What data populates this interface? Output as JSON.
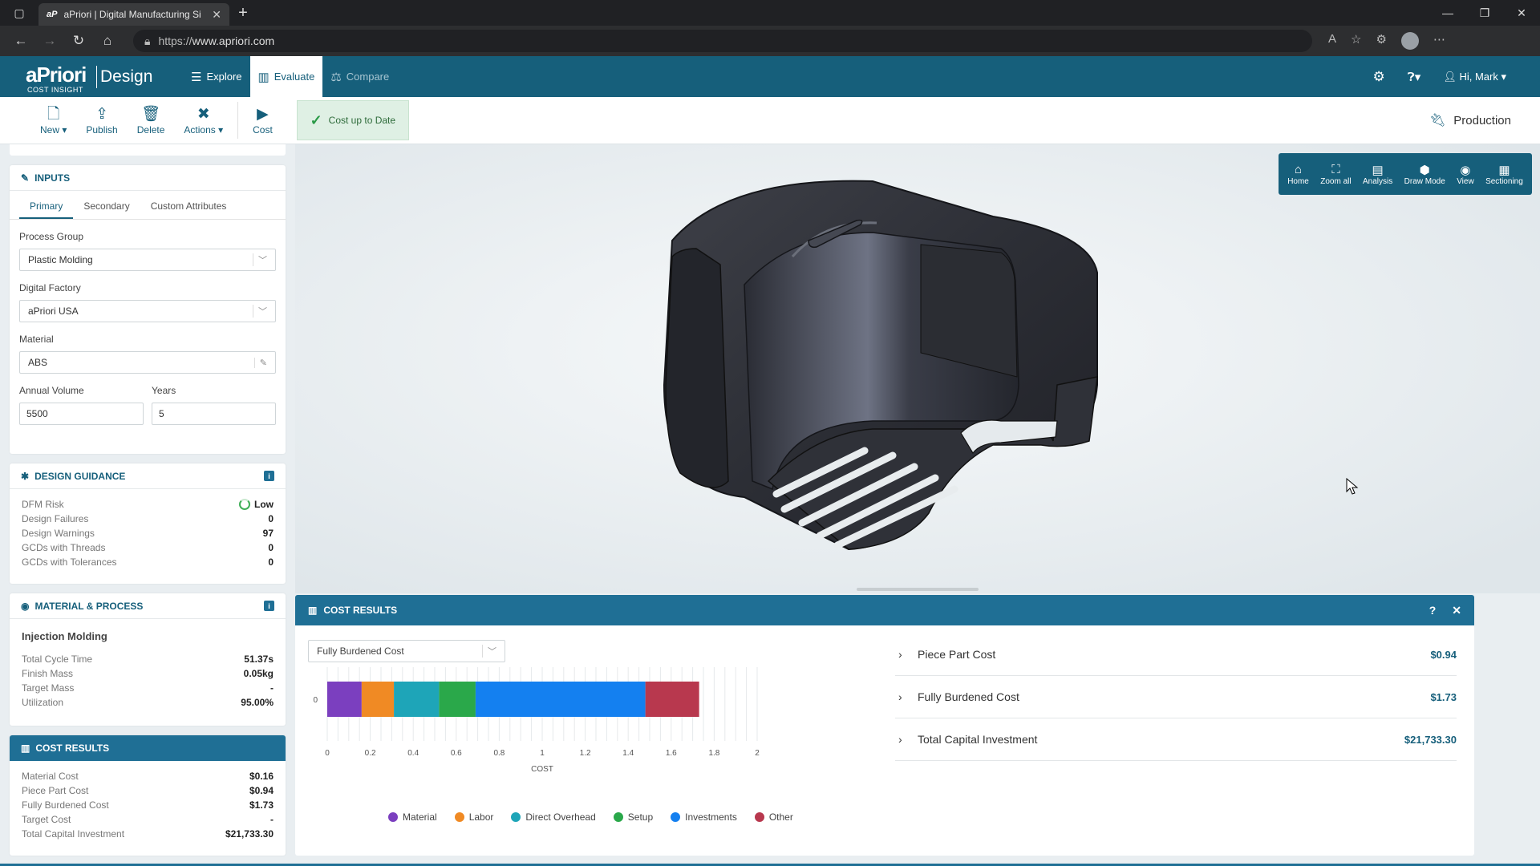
{
  "browser": {
    "tab_favicon": "aP",
    "tab_title": "aPriori | Digital Manufacturing Si",
    "url_scheme": "https://",
    "url_host": "www.apriori.com"
  },
  "header": {
    "logo_main": "aPriori",
    "logo_sub": "COST INSIGHT",
    "logo_product": "Design",
    "nav": [
      {
        "label": "Explore"
      },
      {
        "label": "Evaluate"
      },
      {
        "label": "Compare"
      }
    ],
    "user": "Hi, Mark"
  },
  "toolbar": {
    "new": "New",
    "publish": "Publish",
    "delete": "Delete",
    "actions": "Actions",
    "cost": "Cost",
    "status": "Cost up to Date",
    "scenario_state": "Production"
  },
  "inputs": {
    "title": "INPUTS",
    "tabs": [
      "Primary",
      "Secondary",
      "Custom Attributes"
    ],
    "process_group_label": "Process Group",
    "process_group": "Plastic Molding",
    "digital_factory_label": "Digital Factory",
    "digital_factory": "aPriori USA",
    "material_label": "Material",
    "material": "ABS",
    "annual_volume_label": "Annual Volume",
    "annual_volume": "5500",
    "years_label": "Years",
    "years": "5"
  },
  "design_guidance": {
    "title": "DESIGN GUIDANCE",
    "rows": [
      {
        "k": "DFM Risk",
        "v": "Low"
      },
      {
        "k": "Design Failures",
        "v": "0"
      },
      {
        "k": "Design Warnings",
        "v": "97"
      },
      {
        "k": "GCDs with Threads",
        "v": "0"
      },
      {
        "k": "GCDs with Tolerances",
        "v": "0"
      }
    ]
  },
  "material_process": {
    "title": "MATERIAL & PROCESS",
    "process": "Injection Molding",
    "rows": [
      {
        "k": "Total Cycle Time",
        "v": "51.37s"
      },
      {
        "k": "Finish Mass",
        "v": "0.05kg"
      },
      {
        "k": "Target Mass",
        "v": "-"
      },
      {
        "k": "Utilization",
        "v": "95.00%"
      }
    ]
  },
  "cost_results_side": {
    "title": "COST RESULTS",
    "rows": [
      {
        "k": "Material Cost",
        "v": "$0.16"
      },
      {
        "k": "Piece Part Cost",
        "v": "$0.94"
      },
      {
        "k": "Fully Burdened Cost",
        "v": "$1.73"
      },
      {
        "k": "Target Cost",
        "v": "-"
      },
      {
        "k": "Total Capital Investment",
        "v": "$21,733.30"
      }
    ]
  },
  "viewer_toolbar": [
    "Home",
    "Zoom all",
    "Analysis",
    "Draw Mode",
    "View",
    "Sectioning"
  ],
  "cost_results_panel": {
    "title": "COST RESULTS",
    "help": "?",
    "close": "✕",
    "selector": "Fully Burdened Cost",
    "summary": [
      {
        "label": "Piece Part Cost",
        "amount": "$0.94"
      },
      {
        "label": "Fully Burdened Cost",
        "amount": "$1.73"
      },
      {
        "label": "Total Capital Investment",
        "amount": "$21,733.30"
      }
    ]
  },
  "chart_data": {
    "type": "bar",
    "orientation": "horizontal-stacked",
    "categories": [
      "0"
    ],
    "series": [
      {
        "name": "Material",
        "values": [
          0.16
        ],
        "color": "#7b3fbf"
      },
      {
        "name": "Labor",
        "values": [
          0.15
        ],
        "color": "#f08a24"
      },
      {
        "name": "Direct Overhead",
        "values": [
          0.21
        ],
        "color": "#1ea5b8"
      },
      {
        "name": "Setup",
        "values": [
          0.17
        ],
        "color": "#2aa84a"
      },
      {
        "name": "Investments",
        "values": [
          0.79
        ],
        "color": "#1480f0"
      },
      {
        "name": "Other",
        "values": [
          0.25
        ],
        "color": "#b8384e"
      }
    ],
    "xlabel": "COST",
    "xlim": [
      0,
      2
    ],
    "xticks": [
      "0",
      "0.2",
      "0.4",
      "0.6",
      "0.8",
      "1",
      "1.2",
      "1.4",
      "1.6",
      "1.8",
      "2"
    ],
    "legend_position": "bottom"
  }
}
